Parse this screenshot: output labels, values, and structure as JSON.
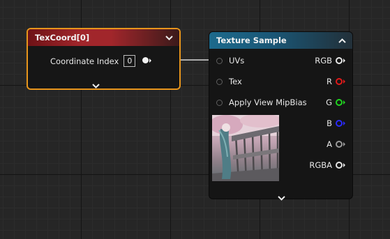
{
  "texcoord_node": {
    "title": "TexCoord[0]",
    "coordinate_index_label": "Coordinate Index",
    "coordinate_index_value": "0",
    "collapse_icon": "chevron-down-icon",
    "expand_icon": "chevron-down-icon",
    "header_color": "#8f1f24",
    "selection_color": "#e8961c"
  },
  "texture_sample_node": {
    "title": "Texture Sample",
    "collapse_icon": "chevron-up-icon",
    "expand_icon": "chevron-down-icon",
    "header_color": "#1b5f7e",
    "inputs": [
      {
        "label": "UVs"
      },
      {
        "label": "Tex"
      },
      {
        "label": "Apply View MipBias"
      }
    ],
    "outputs": [
      {
        "label": "RGB",
        "color": "#e6e6e6"
      },
      {
        "label": "R",
        "color": "#e01a1a"
      },
      {
        "label": "G",
        "color": "#1fd41f"
      },
      {
        "label": "B",
        "color": "#2a2aff"
      },
      {
        "label": "A",
        "color": "#9a9a9a"
      },
      {
        "label": "RGBA",
        "color": "#e6e6e6"
      }
    ],
    "preview_icon": "texture-preview-image"
  },
  "wire": {
    "color": "#e8e8e8"
  }
}
